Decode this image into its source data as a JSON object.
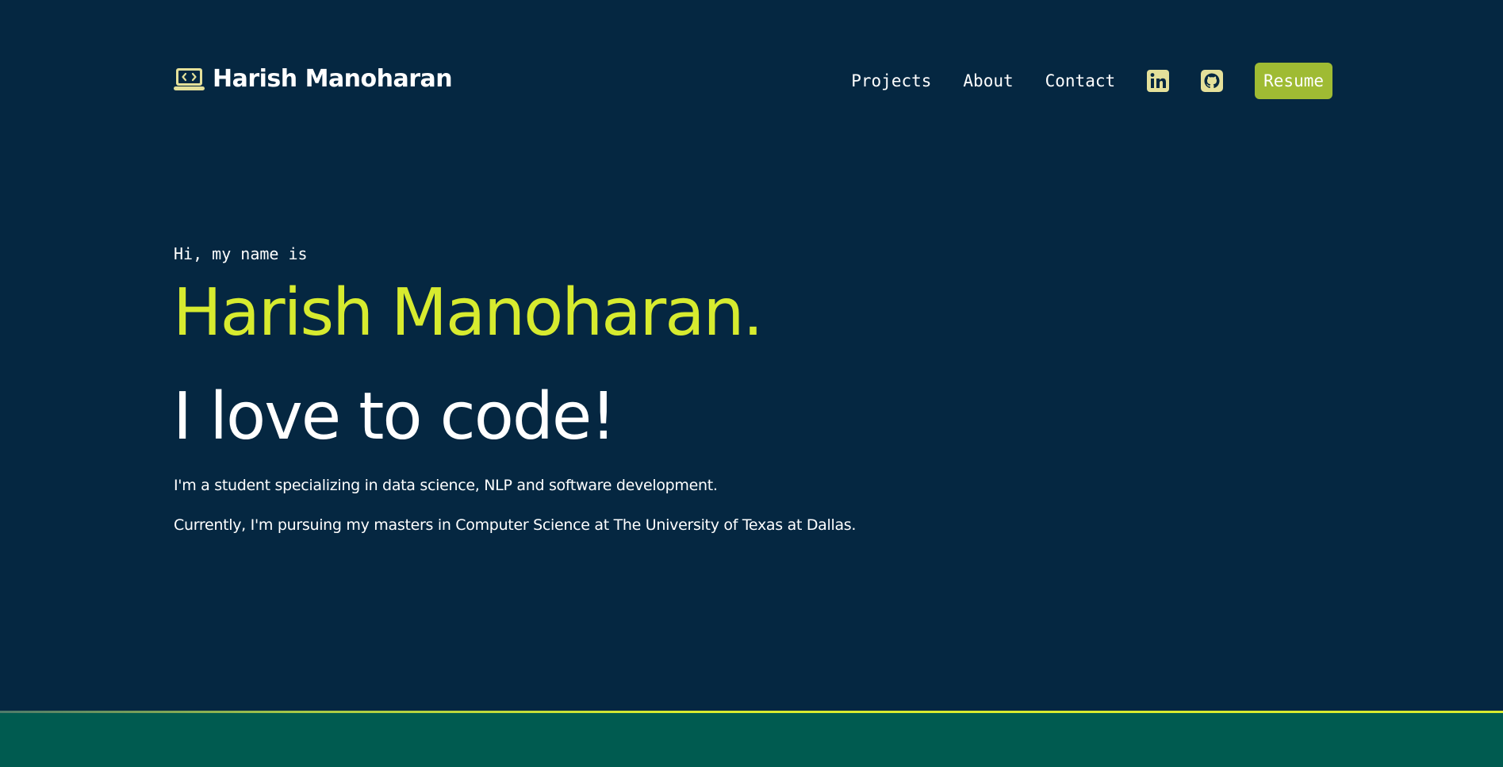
{
  "header": {
    "brand_name": "Harish Manoharan",
    "brand_icon": "laptop-code-icon",
    "nav": [
      {
        "label": "Projects"
      },
      {
        "label": "About"
      },
      {
        "label": "Contact"
      }
    ],
    "social": [
      {
        "icon": "linkedin-icon"
      },
      {
        "icon": "github-icon"
      }
    ],
    "resume_label": "Resume"
  },
  "hero": {
    "greeting": "Hi, my name is",
    "name": "Harish Manoharan.",
    "tagline": "I love to code!",
    "bio": [
      "I'm a student specializing in data science, NLP and software development.",
      "Currently, I'm pursuing my masters in Computer Science at The University of Texas at Dallas."
    ]
  },
  "colors": {
    "background": "#052741",
    "accent": "#d7eb2f",
    "button": "#9fbb33",
    "icon": "#e4e09a",
    "footer": "#005b50"
  }
}
